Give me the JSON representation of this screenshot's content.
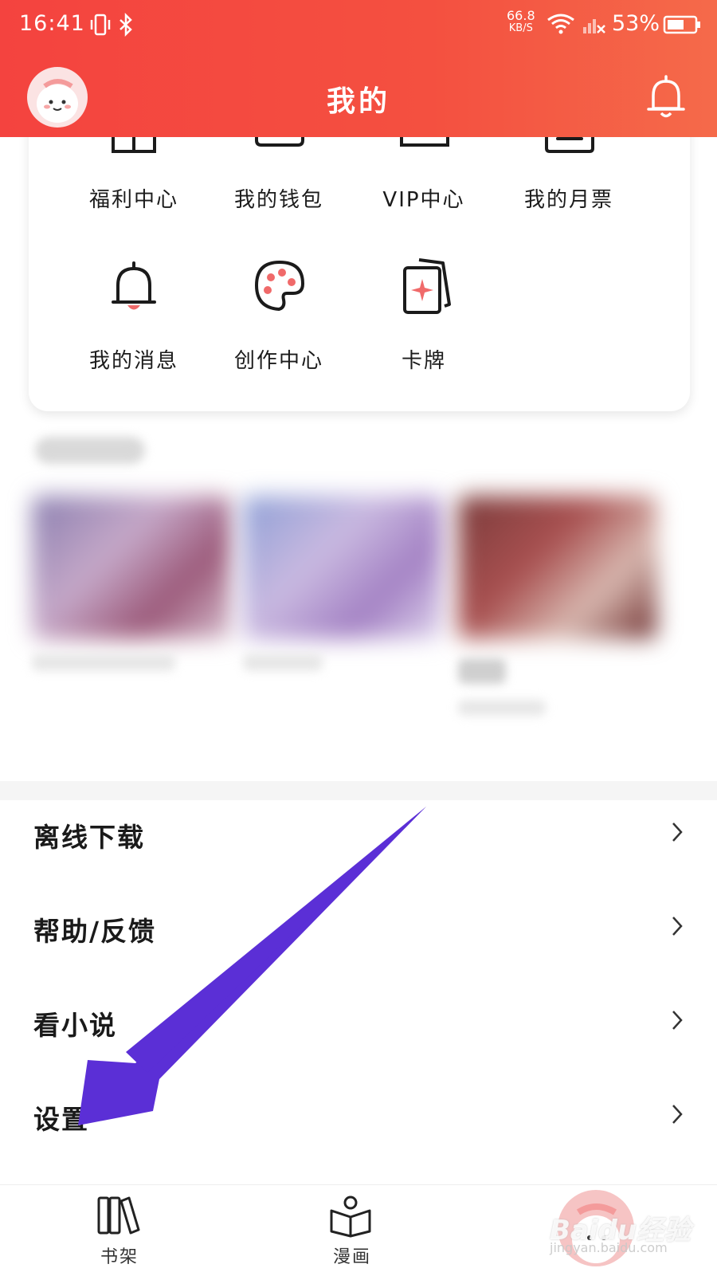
{
  "status_bar": {
    "time": "16:41",
    "net_speed_value": "66.8",
    "net_speed_unit": "KB/S",
    "battery_pct": "53%"
  },
  "header": {
    "title": "我的"
  },
  "grid": [
    {
      "label": "福利中心",
      "icon": "gift-icon"
    },
    {
      "label": "我的钱包",
      "icon": "wallet-icon"
    },
    {
      "label": "VIP中心",
      "icon": "vip-icon"
    },
    {
      "label": "我的月票",
      "icon": "ticket-icon"
    },
    {
      "label": "我的消息",
      "icon": "bell-icon"
    },
    {
      "label": "创作中心",
      "icon": "palette-icon"
    },
    {
      "label": "卡牌",
      "icon": "cards-icon"
    }
  ],
  "menu": [
    {
      "label": "离线下载"
    },
    {
      "label": "帮助/反馈"
    },
    {
      "label": "看小说"
    },
    {
      "label": "设置"
    }
  ],
  "bottom_nav": [
    {
      "label": "书架",
      "icon": "bookshelf-icon"
    },
    {
      "label": "漫画",
      "icon": "comic-book-icon"
    },
    {
      "label": "",
      "icon": "profile-avatar-icon"
    }
  ],
  "watermark": {
    "text": "Baidu经验",
    "sub": "jingyan.baidu.com"
  },
  "colors": {
    "header": "#f4433f",
    "accent_arrow": "#5b2fd6",
    "icon_accent": "#f06a6a"
  }
}
